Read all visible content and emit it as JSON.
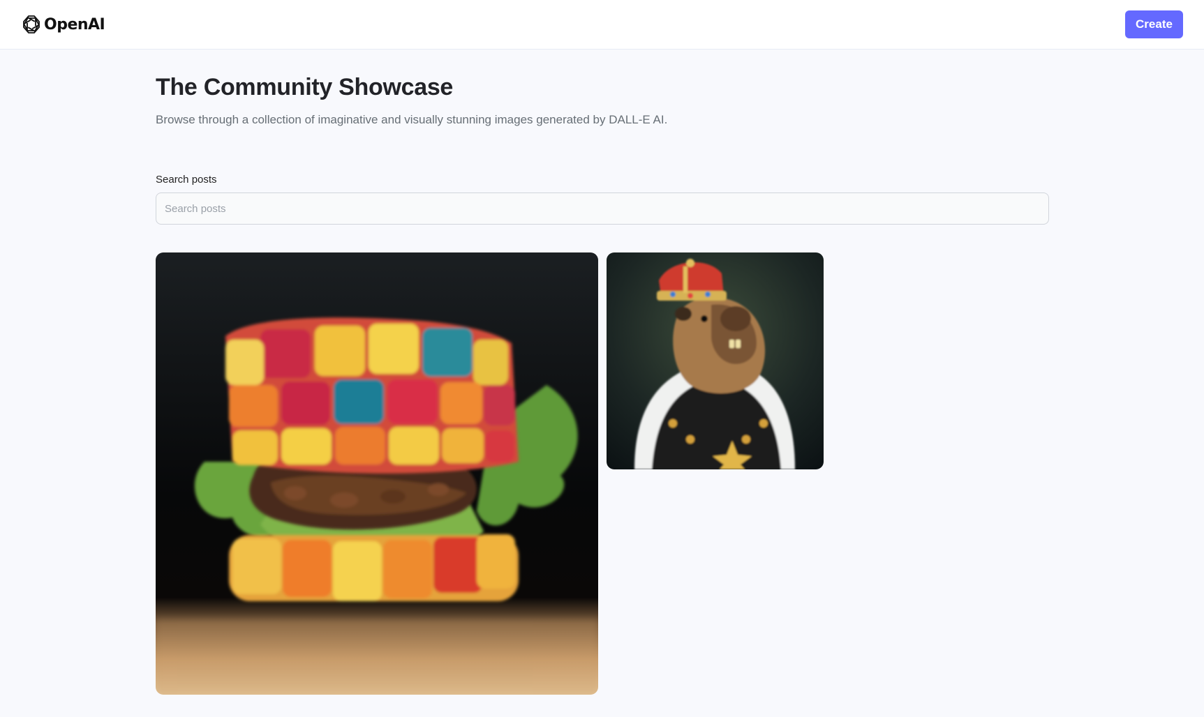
{
  "header": {
    "brand": "OpenAI",
    "create_label": "Create"
  },
  "hero": {
    "title": "The Community Showcase",
    "subtitle": "Browse through a collection of imaginative and visually stunning images generated by DALL-E AI."
  },
  "search": {
    "label": "Search posts",
    "placeholder": "Search posts",
    "value": ""
  },
  "posts": [
    {
      "image": "rubiks-cube-burger"
    },
    {
      "image": "capybara-king-portrait"
    }
  ],
  "colors": {
    "accent": "#6469ff",
    "background": "#f8f9fd",
    "title": "#222328",
    "subtitle": "#666e75"
  }
}
